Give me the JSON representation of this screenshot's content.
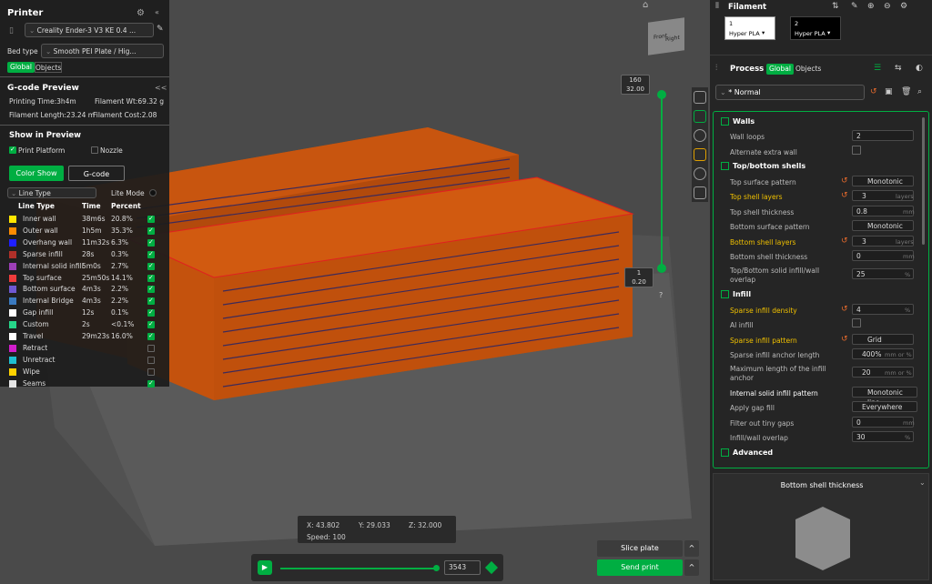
{
  "printer": {
    "title": "Printer",
    "model": "Creality Ender-3 V3 KE 0.4 ...",
    "bed_label": "Bed type",
    "bed_value": "Smooth PEI Plate / Hig...",
    "tab_global": "Global",
    "tab_objects": "Objects"
  },
  "gcode": {
    "title": "G-code Preview",
    "collapse": "<<",
    "print_time": "Printing Time:3h4m",
    "filament_wt": "Filament Wt:69.32 g",
    "filament_len": "Filament Length:23.24 m",
    "filament_cost": "Filament Cost:2.08",
    "show_title": "Show in Preview",
    "print_platform": "Print Platform",
    "nozzle": "Nozzle",
    "color_show": "Color Show",
    "gcode_btn": "G-code",
    "line_type_select": "Line Type",
    "lite_mode": "Lite Mode",
    "col_type": "Line Type",
    "col_time": "Time",
    "col_percent": "Percent",
    "rows": [
      {
        "name": "Inner wall",
        "time": "38m6s",
        "pct": "20.8%",
        "color": "#ffe600",
        "on": true
      },
      {
        "name": "Outer wall",
        "time": "1h5m",
        "pct": "35.3%",
        "color": "#ff8c00",
        "on": true
      },
      {
        "name": "Overhang wall",
        "time": "11m32s",
        "pct": "6.3%",
        "color": "#1f1fff",
        "on": true
      },
      {
        "name": "Sparse infill",
        "time": "28s",
        "pct": "0.3%",
        "color": "#b03029",
        "on": true
      },
      {
        "name": "Internal solid infill",
        "time": "5m0s",
        "pct": "2.7%",
        "color": "#9c3fb6",
        "on": true
      },
      {
        "name": "Top surface",
        "time": "25m50s",
        "pct": "14.1%",
        "color": "#f03c3c",
        "on": true
      },
      {
        "name": "Bottom surface",
        "time": "4m3s",
        "pct": "2.2%",
        "color": "#6f58d2",
        "on": true
      },
      {
        "name": "Internal Bridge",
        "time": "4m3s",
        "pct": "2.2%",
        "color": "#3a7ac0",
        "on": true
      },
      {
        "name": "Gap infill",
        "time": "12s",
        "pct": "0.1%",
        "color": "#ffffff",
        "on": true
      },
      {
        "name": "Custom",
        "time": "2s",
        "pct": "<0.1%",
        "color": "#26d68a",
        "on": true
      },
      {
        "name": "Travel",
        "time": "29m23s",
        "pct": "16.0%",
        "color": "#ffffff",
        "on": true
      },
      {
        "name": "Retract",
        "time": "",
        "pct": "",
        "color": "#d21ecc",
        "on": false
      },
      {
        "name": "Unretract",
        "time": "",
        "pct": "",
        "color": "#1ec0d2",
        "on": false
      },
      {
        "name": "Wipe",
        "time": "",
        "pct": "",
        "color": "#ffd200",
        "on": false
      },
      {
        "name": "Seams",
        "time": "",
        "pct": "",
        "color": "#e6e6e6",
        "on": true
      }
    ]
  },
  "viewport": {
    "slider_top_1": "160",
    "slider_top_2": "32.00",
    "slider_bot_1": "1",
    "slider_bot_2": "0.20",
    "help": "?",
    "cube_top": "Top",
    "cube_front": "Front",
    "cube_right": "Right",
    "coord_x": "X: 43.802",
    "coord_y": "Y: 29.033",
    "coord_z": "Z: 32.000",
    "speed": "Speed: 100",
    "layer_value": "3543",
    "slice_plate": "Slice plate",
    "send_print": "Send print",
    "caret": "^"
  },
  "filament": {
    "title": "Filament",
    "f1_num": "1",
    "f1_name": "Hyper PLA",
    "f2_num": "2",
    "f2_name": "Hyper PLA"
  },
  "process": {
    "title": "Process",
    "tab_global": "Global",
    "tab_objects": "Objects",
    "preset": "* Normal",
    "sections": {
      "walls": "Walls",
      "topbottom": "Top/bottom shells",
      "infill": "Infill",
      "advanced": "Advanced"
    },
    "items": {
      "wall_loops": {
        "label": "Wall loops",
        "value": "2"
      },
      "alt_wall": {
        "label": "Alternate extra wall"
      },
      "top_pattern": {
        "label": "Top surface pattern",
        "value": "Monotonic"
      },
      "top_layers": {
        "label": "Top shell layers",
        "value": "3",
        "unit": "layers"
      },
      "top_thick": {
        "label": "Top shell thickness",
        "value": "0.8",
        "unit": "mm"
      },
      "bottom_pattern": {
        "label": "Bottom surface pattern",
        "value": "Monotonic"
      },
      "bottom_layers": {
        "label": "Bottom shell layers",
        "value": "3",
        "unit": "layers"
      },
      "bottom_thick": {
        "label": "Bottom shell thickness",
        "value": "0",
        "unit": "mm"
      },
      "tb_overlap": {
        "label": "Top/Bottom solid infill/wall",
        "label2": "overlap",
        "value": "25",
        "unit": "%"
      },
      "sparse_density": {
        "label": "Sparse infill density",
        "value": "4",
        "unit": "%"
      },
      "ai_infill": {
        "label": "AI infill"
      },
      "sparse_pattern": {
        "label": "Sparse infill pattern",
        "value": "Grid"
      },
      "anchor": {
        "label": "Sparse infill anchor length",
        "value": "400%",
        "unit": "mm or %"
      },
      "anchor_max": {
        "label": "Maximum length of the infill",
        "label2": "anchor",
        "value": "20",
        "unit": "mm or %"
      },
      "internal_pattern": {
        "label": "Internal solid infill pattern",
        "value": "Monotonic line"
      },
      "gap_fill": {
        "label": "Apply gap fill",
        "value": "Everywhere"
      },
      "tiny_gaps": {
        "label": "Filter out tiny gaps",
        "value": "0",
        "unit": "mm"
      },
      "iw_overlap": {
        "label": "Infill/wall overlap",
        "value": "30",
        "unit": "%"
      }
    }
  },
  "help_panel": {
    "title": "Bottom shell thickness"
  }
}
